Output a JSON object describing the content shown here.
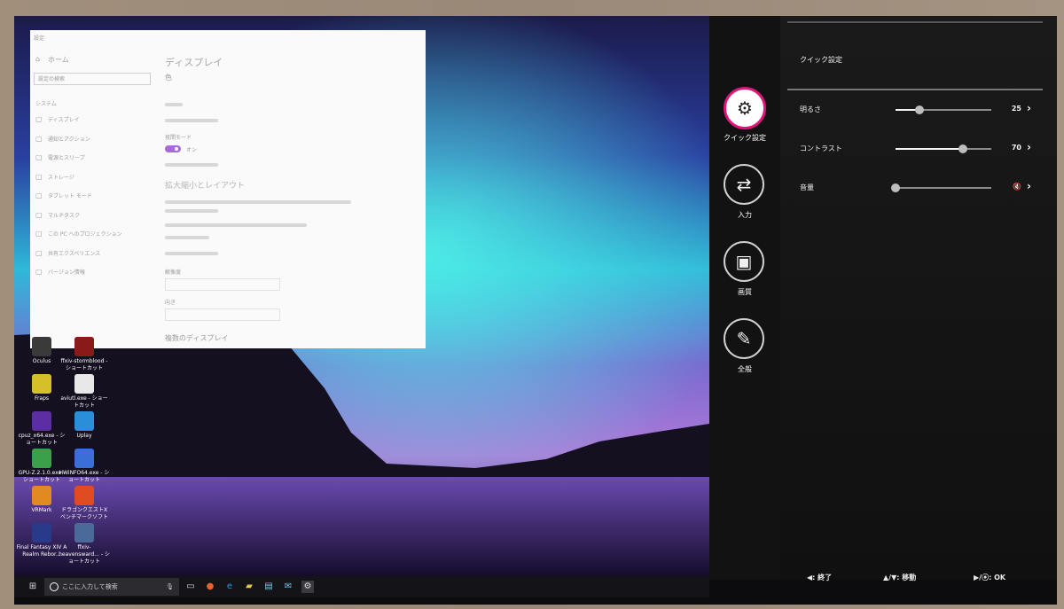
{
  "desktop": {
    "icons": [
      {
        "label": "Oculus",
        "color": "#3a3a3a"
      },
      {
        "label": "ffxiv-stormblood - ショートカット",
        "color": "#8a1a1a"
      },
      {
        "label": "Fraps",
        "color": "#d4c028"
      },
      {
        "label": "aviutl.exe - ショートカット",
        "color": "#e8e8e8"
      },
      {
        "label": "cpuz_x64.exe - ショートカット",
        "color": "#5b2fa0"
      },
      {
        "label": "Uplay",
        "color": "#2a8fd8"
      },
      {
        "label": "GPU-Z.2.1.0.exe - ショートカット",
        "color": "#3aa04a"
      },
      {
        "label": "HWiNFO64.exe - ショートカット",
        "color": "#3a6fd8"
      },
      {
        "label": "VRMark",
        "color": "#e08a20"
      },
      {
        "label": "ドラゴンクエストX ベンチマークソフト",
        "color": "#e04a20"
      },
      {
        "label": "Final Fantasy XIV A Realm Rebor...",
        "color": "#2a3a8a"
      },
      {
        "label": "ffxiv-heavensward... - ショートカット",
        "color": "#4a6a9a"
      }
    ]
  },
  "settings": {
    "app_label": "設定",
    "home": "ホーム",
    "search_placeholder": "設定の検索",
    "section": "システム",
    "nav": [
      "ディスプレイ",
      "通知とアクション",
      "電源とスリープ",
      "ストレージ",
      "タブレット モード",
      "マルチタスク",
      "この PC へのプロジェクション",
      "共有エクスペリエンス",
      "バージョン情報"
    ],
    "page_title": "ディスプレイ",
    "subheading": "色",
    "night_light_label": "夜間モード",
    "toggle_state": "オン",
    "layout_heading": "拡大縮小とレイアウト",
    "resolution_label": "解像度",
    "orientation_label": "向き",
    "multi_display": "複数のディスプレイ"
  },
  "taskbar": {
    "search_placeholder": "ここに入力して検索"
  },
  "osd": {
    "menu": [
      {
        "label": "クイック設定",
        "icon": "gear-icon",
        "active": true
      },
      {
        "label": "入力",
        "icon": "input-icon",
        "active": false
      },
      {
        "label": "画質",
        "icon": "picture-icon",
        "active": false
      },
      {
        "label": "全般",
        "icon": "tools-icon",
        "active": false
      }
    ],
    "panel_title": "クイック設定",
    "rows": [
      {
        "label": "明るさ",
        "value": "25",
        "level": 0.25
      },
      {
        "label": "コントラスト",
        "value": "70",
        "level": 0.7
      },
      {
        "label": "音量",
        "value": "",
        "level": 0.0,
        "muted": true
      }
    ],
    "help": [
      {
        "keys": "◀:",
        "label": "終了"
      },
      {
        "keys": "▲/▼:",
        "label": "移動"
      },
      {
        "keys": "▶/⦿:",
        "label": "OK"
      }
    ],
    "accent": "#e0157c"
  }
}
